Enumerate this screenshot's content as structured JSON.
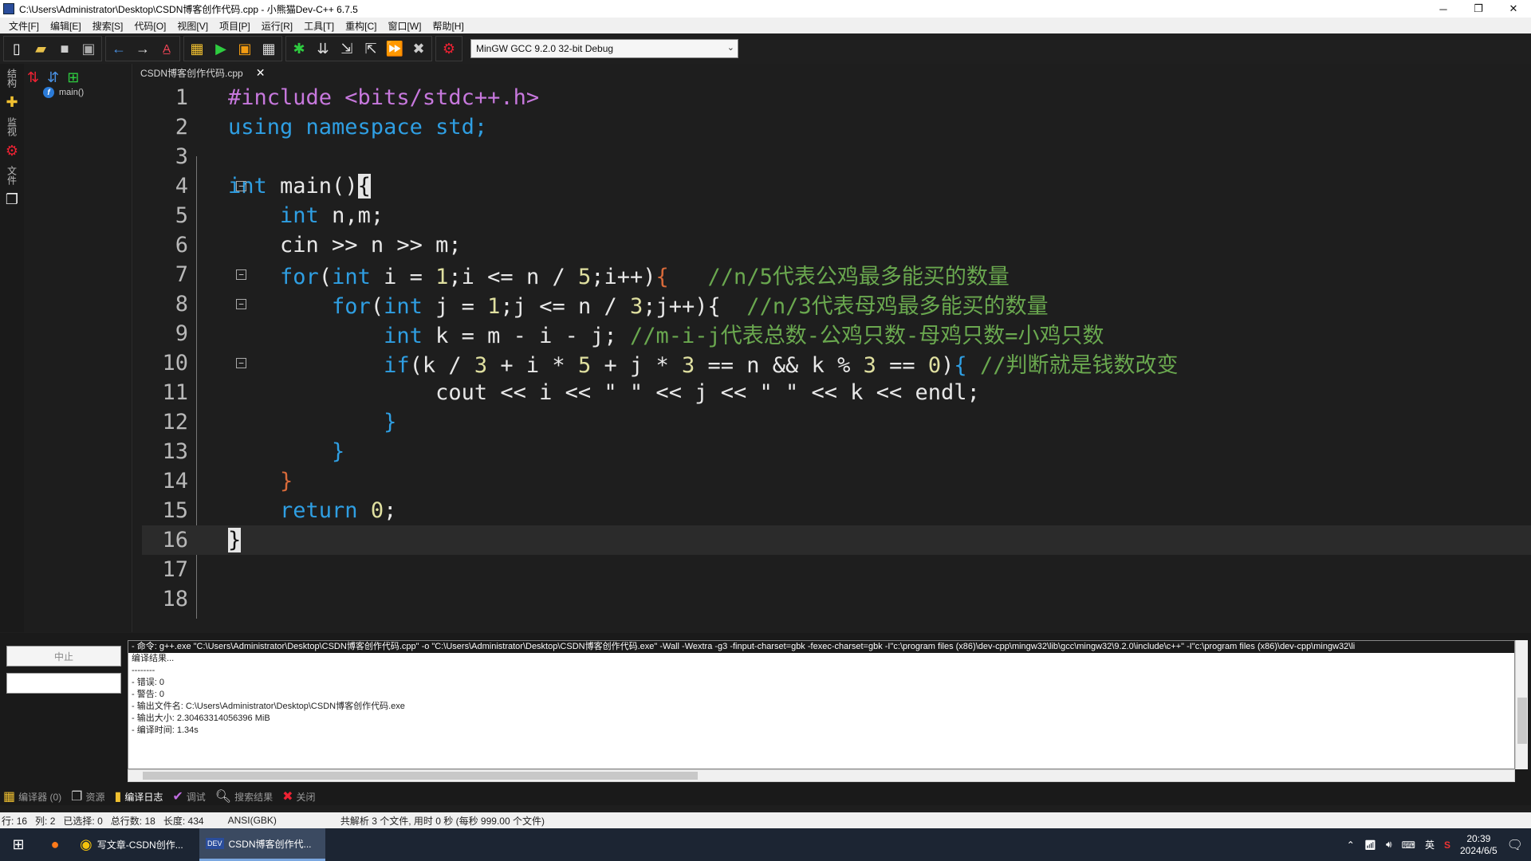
{
  "window": {
    "title": "C:\\Users\\Administrator\\Desktop\\CSDN博客创作代码.cpp - 小熊猫Dev-C++ 6.7.5",
    "minimize": "─",
    "restore": "❐",
    "close": "✕"
  },
  "menu": [
    "文件[F]",
    "编辑[E]",
    "搜索[S]",
    "代码[O]",
    "视图[V]",
    "项目[P]",
    "运行[R]",
    "工具[T]",
    "重构[C]",
    "窗口[W]",
    "帮助[H]"
  ],
  "toolbar": {
    "compiler": "MinGW GCC 9.2.0 32-bit Debug"
  },
  "side_tabs": [
    "结构",
    "监视",
    "文件"
  ],
  "class_tree": {
    "item": "main()"
  },
  "editor": {
    "tab_label": "CSDN博客创作代码.cpp",
    "lines": [
      {
        "n": "1"
      },
      {
        "n": "2"
      },
      {
        "n": "3"
      },
      {
        "n": "4"
      },
      {
        "n": "5"
      },
      {
        "n": "6"
      },
      {
        "n": "7"
      },
      {
        "n": "8"
      },
      {
        "n": "9"
      },
      {
        "n": "10"
      },
      {
        "n": "11"
      },
      {
        "n": "12"
      },
      {
        "n": "13"
      },
      {
        "n": "14"
      },
      {
        "n": "15"
      },
      {
        "n": "16"
      },
      {
        "n": "17"
      },
      {
        "n": "18"
      }
    ],
    "code": {
      "l1": "#include <bits/stdc++.h>",
      "l2_kw": "using namespace",
      "l2_rest": " std;",
      "l4_kw": "int",
      "l4_rest": " main()",
      "l4_brace": "{",
      "l5_kw": "int",
      "l5_rest": " n,m;",
      "l6": "cin >> n >> m;",
      "l7_kw1": "for",
      "l7_p1": "(",
      "l7_kw2": "int",
      "l7_rest": " i = ",
      "l7_n1": "1",
      "l7_rest2": ";i <= n / ",
      "l7_n2": "5",
      "l7_rest3": ";i++)",
      "l7_brace": "{",
      "l7_cm": "   //n/5代表公鸡最多能买的数量",
      "l8_kw1": "for",
      "l8_p1": "(",
      "l8_kw2": "int",
      "l8_rest": " j = ",
      "l8_n1": "1",
      "l8_rest2": ";j <= n / ",
      "l8_n2": "3",
      "l8_rest3": ";j++){",
      "l8_cm": "  //n/3代表母鸡最多能买的数量",
      "l9_kw": "int",
      "l9_rest": " k = m - i - j; ",
      "l9_cm": "//m-i-j代表总数-公鸡只数-母鸡只数=小鸡只数",
      "l10_kw": "if",
      "l10_a": "(k / ",
      "l10_n1": "3",
      "l10_b": " + i * ",
      "l10_n2": "5",
      "l10_c": " + j * ",
      "l10_n3": "3",
      "l10_d": " == n && k % ",
      "l10_n4": "3",
      "l10_e": " == ",
      "l10_n5": "0",
      "l10_f": ")",
      "l10_brace": "{",
      "l10_cm": " //判断就是钱数改变",
      "l11": "cout << i << \" \" << j << \" \" << k << endl;",
      "l12": "}",
      "l13": "}",
      "l14": "}",
      "l15_kw": "return",
      "l15_sp": " ",
      "l15_n": "0",
      "l15_end": ";",
      "l16": "}"
    }
  },
  "bottom": {
    "stop_button": "中止",
    "log": [
      "- 命令: g++.exe \"C:\\Users\\Administrator\\Desktop\\CSDN博客创作代码.cpp\" -o \"C:\\Users\\Administrator\\Desktop\\CSDN博客创作代码.exe\" -Wall -Wextra -g3 -finput-charset=gbk -fexec-charset=gbk -I\"c:\\program files (x86)\\dev-cpp\\mingw32\\lib\\gcc\\mingw32\\9.2.0\\include\\c++\" -I\"c:\\program files (x86)\\dev-cpp\\mingw32\\li",
      "",
      "编译结果...",
      "--------",
      "- 错误: 0",
      "- 警告: 0",
      "- 输出文件名: C:\\Users\\Administrator\\Desktop\\CSDN博客创作代码.exe",
      "- 输出大小: 2.30463314056396 MiB",
      "- 编译时间: 1.34s"
    ],
    "tabs": [
      "编译器 (0)",
      "资源",
      "编译日志",
      "调试",
      "搜索结果",
      "关闭"
    ]
  },
  "status": {
    "row_label": "行:",
    "row": "16",
    "col_label": "列:",
    "col": "2",
    "sel_label": "已选择:",
    "sel": "0",
    "total_label": "总行数:",
    "total": "18",
    "len_label": "长度:",
    "len": "434",
    "encoding": "ANSI(GBK)",
    "parse": "共解析 3 个文件, 用时 0 秒 (每秒 999.00 个文件)"
  },
  "taskbar": {
    "task1": "写文章-CSDN创作...",
    "task2": "CSDN博客创作代...",
    "ime": "英",
    "time": "20:39",
    "date": "2024/6/5"
  }
}
